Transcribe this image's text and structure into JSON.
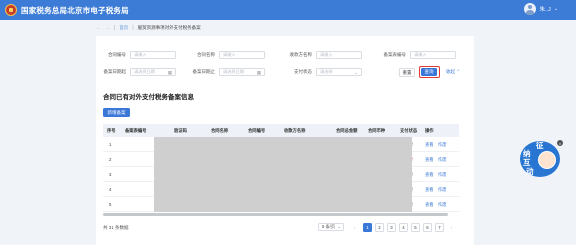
{
  "header": {
    "brand": "国家税务总局北京市电子税务局",
    "user": "朱..J"
  },
  "breadcrumb": {
    "home": "首页",
    "current": "服贸资源事项对外支付税务备案"
  },
  "filters": {
    "contract_no": {
      "label": "合同编号",
      "placeholder": "请输入"
    },
    "contract_name": {
      "label": "合同名称",
      "placeholder": "请输入"
    },
    "payee_name": {
      "label": "收款方名称",
      "placeholder": "请输入"
    },
    "record_no": {
      "label": "备案表编号",
      "placeholder": "请输入"
    },
    "date_from": {
      "label": "备案日期起",
      "placeholder": "请选择日期"
    },
    "date_to": {
      "label": "备案日期止",
      "placeholder": "请选择日期"
    },
    "pay_status": {
      "label": "支付状态",
      "placeholder": "请选择"
    },
    "reset": "重置",
    "query": "查询",
    "collapse": "收起"
  },
  "section_title": "合同已有对外支付税务备案信息",
  "add_button": "新增备案",
  "table": {
    "headers": [
      "序号",
      "备案表编号",
      "验证码",
      "合同名称",
      "合同编号",
      "收款方名称",
      "合同总金额",
      "合同币种",
      "支付状态",
      "操作"
    ],
    "rows": [
      {
        "idx": "1",
        "status": "已支付",
        "unpaid": false,
        "view": "查看",
        "op": "作废"
      },
      {
        "idx": "2",
        "status": "未支付",
        "unpaid": true,
        "view": "查看",
        "op": "作废"
      },
      {
        "idx": "3",
        "status": "已支付",
        "unpaid": false,
        "view": "查看",
        "op": "作废"
      },
      {
        "idx": "4",
        "status": "已支付",
        "unpaid": false,
        "view": "查看",
        "op": "作废"
      },
      {
        "idx": "5",
        "status": "已支付",
        "unpaid": false,
        "view": "查看",
        "op": "作废"
      }
    ]
  },
  "pagination": {
    "total": "共 31 条数据",
    "page_size": "5 条/页",
    "pages": [
      "1",
      "2",
      "3",
      "4",
      "5",
      "6",
      "7"
    ],
    "current": "1",
    "prev": "‹",
    "next": "›"
  },
  "mascot": {
    "chars": [
      "征",
      "纳",
      "互",
      "动"
    ]
  },
  "colors": {
    "primary": "#3a78d8",
    "header": "#3c7bd6",
    "unpaid": "#e53935",
    "highlight": "#e53935"
  }
}
